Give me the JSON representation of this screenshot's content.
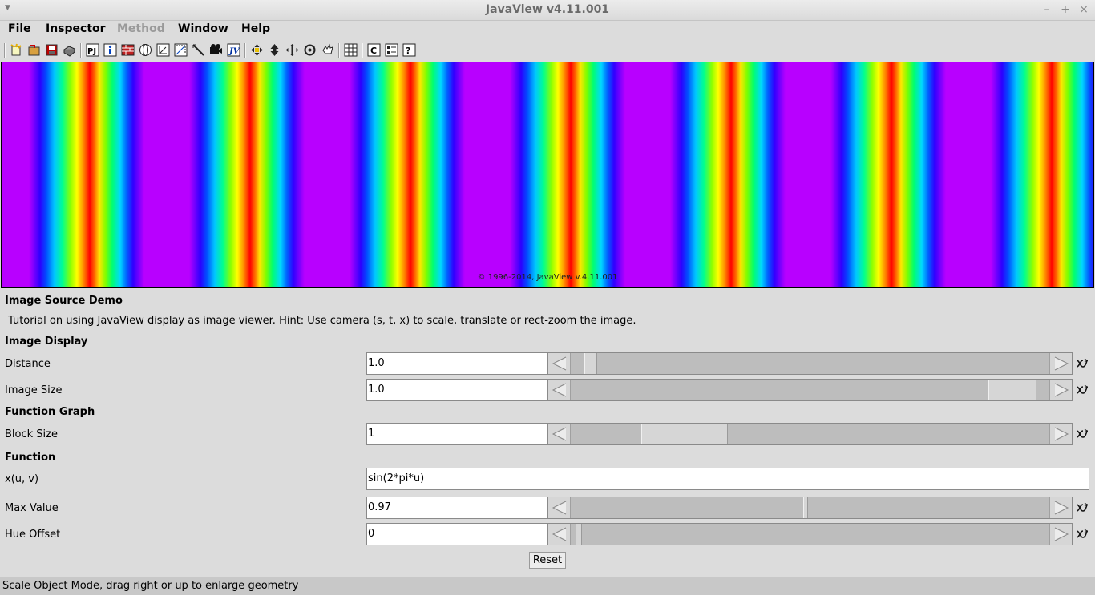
{
  "window": {
    "title": "JavaView v4.11.001"
  },
  "menubar": {
    "items": [
      {
        "label": "File",
        "enabled": true
      },
      {
        "label": "Inspector",
        "enabled": true
      },
      {
        "label": "Method",
        "enabled": false
      },
      {
        "label": "Window",
        "enabled": true
      },
      {
        "label": "Help",
        "enabled": true
      }
    ]
  },
  "toolbar": {
    "icons": [
      "new-icon",
      "open-icon",
      "save-icon",
      "print-icon",
      "pj-icon",
      "info-icon",
      "brick-icon",
      "globe-icon",
      "boundingbox-icon",
      "axes-icon",
      "ruler-icon",
      "camera-icon",
      "jv-icon",
      "pick-icon",
      "scale-icon",
      "translate-icon",
      "rotate-icon",
      "hand-icon",
      "grid-icon",
      "c-icon",
      "list-icon",
      "help-icon"
    ]
  },
  "canvas": {
    "copyright": "© 1996-2014, JavaView v.4.11.001"
  },
  "panel": {
    "title": "Image Source Demo",
    "description": "Tutorial on using JavaView display as image viewer. Hint: Use camera (s, t, x) to scale, translate or rect-zoom the image.",
    "sections": {
      "image_display": "Image Display",
      "function_graph": "Function Graph",
      "function": "Function"
    },
    "distance": {
      "label": "Distance",
      "value": "1.0",
      "slider_fraction": 0.03
    },
    "image_size": {
      "label": "Image Size",
      "value": "1.0",
      "slider_fraction": 0.97
    },
    "block_size": {
      "label": "Block Size",
      "value": "1",
      "slider_fraction": 0.18
    },
    "fx": {
      "label": "x(u, v)",
      "value": "sin(2*pi*u)"
    },
    "max_value": {
      "label": "Max Value",
      "value": "0.97",
      "slider_fraction": 0.49
    },
    "hue_offset": {
      "label": "Hue Offset",
      "value": "0",
      "slider_fraction": 0.01
    },
    "reset_label": "Reset"
  },
  "statusbar": {
    "text": "Scale Object Mode, drag right or up to enlarge geometry"
  }
}
